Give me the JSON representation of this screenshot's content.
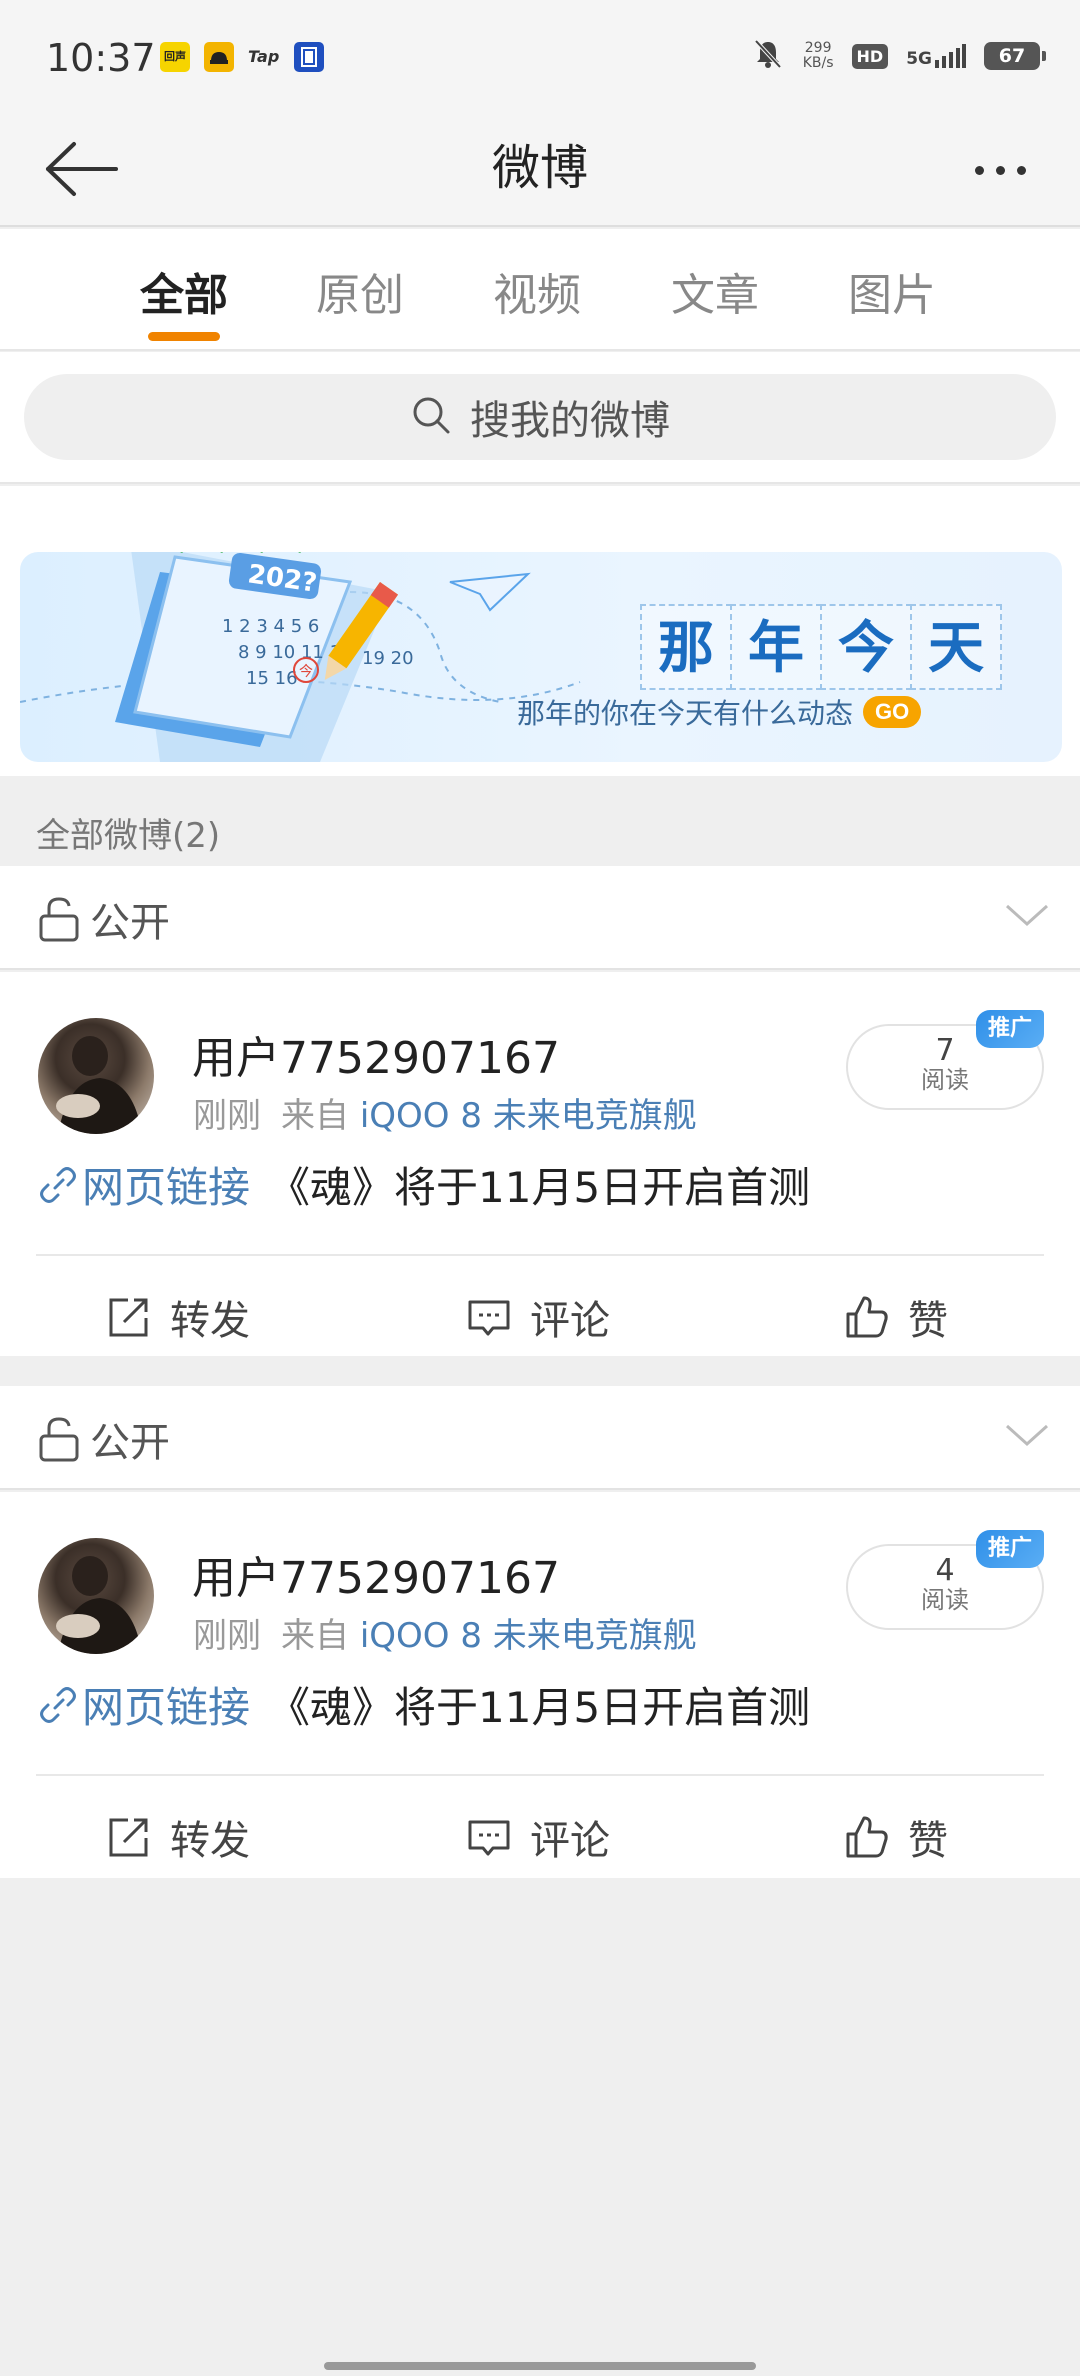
{
  "status_bar": {
    "time": "10:37",
    "net_speed_value": "299",
    "net_speed_unit": "KB/s",
    "hd_label": "HD",
    "network_label": "5G",
    "battery": "67",
    "app_icons": [
      "weibo-mini-app-icon",
      "taxi-app-icon",
      "taptap-app-icon",
      "film-app-icon"
    ],
    "app_icon_text": [
      "回声",
      "",
      "Tap",
      ""
    ]
  },
  "header": {
    "title": "微博"
  },
  "tabs": [
    {
      "label": "全部",
      "active": true
    },
    {
      "label": "原创",
      "active": false
    },
    {
      "label": "视频",
      "active": false
    },
    {
      "label": "文章",
      "active": false
    },
    {
      "label": "图片",
      "active": false
    }
  ],
  "search": {
    "placeholder": "搜我的微博"
  },
  "banner": {
    "title_chars": [
      "那",
      "年",
      "今",
      "天"
    ],
    "subtitle": "那年的你在今天有什么动态",
    "go_label": "GO",
    "calendar_year": "202?",
    "calendar_day_marker": "今",
    "colors": {
      "title": "#1a6cc0",
      "go": "#f7a400"
    }
  },
  "section": {
    "label": "全部微博(2)"
  },
  "posts": [
    {
      "privacy_label": "公开",
      "username": "用户7752907167",
      "time": "刚刚",
      "from_prefix": "来自",
      "device": "iQOO 8 未来电竞旗舰",
      "read_count": "7",
      "read_label": "阅读",
      "promo_tag": "推广",
      "link_label": "网页链接",
      "text": "《魂》将于11月5日开启首测",
      "actions": {
        "repost": "转发",
        "comment": "评论",
        "like": "赞"
      }
    },
    {
      "privacy_label": "公开",
      "username": "用户7752907167",
      "time": "刚刚",
      "from_prefix": "来自",
      "device": "iQOO 8 未来电竞旗舰",
      "read_count": "4",
      "read_label": "阅读",
      "promo_tag": "推广",
      "link_label": "网页链接",
      "text": "《魂》将于11月5日开启首测",
      "actions": {
        "repost": "转发",
        "comment": "评论",
        "like": "赞"
      }
    }
  ],
  "theme": {
    "accent": "#f08300",
    "link": "#4a7fb5",
    "promo": "#2f8fe8"
  }
}
